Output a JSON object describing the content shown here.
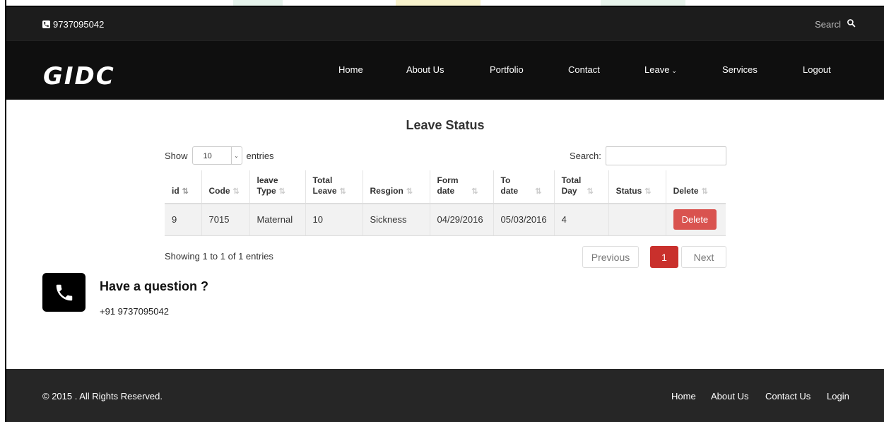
{
  "topbar": {
    "phone": "9737095042",
    "search_label": "Searcl"
  },
  "brand": {
    "logo": "GIDC"
  },
  "nav": {
    "items": [
      {
        "label": "Home"
      },
      {
        "label": "About Us"
      },
      {
        "label": "Portfolio"
      },
      {
        "label": "Contact"
      },
      {
        "label": "Leave",
        "has_dropdown": true
      },
      {
        "label": "Services"
      },
      {
        "label": "Logout"
      }
    ]
  },
  "page": {
    "title": "Leave Status"
  },
  "table_controls": {
    "show_label": "Show",
    "page_size": "10",
    "entries_label": "entries",
    "search_label": "Search:",
    "search_value": ""
  },
  "table": {
    "headers": [
      {
        "line1": "id",
        "line2": ""
      },
      {
        "line1": "Code",
        "line2": ""
      },
      {
        "line1": "leave",
        "line2": "Type"
      },
      {
        "line1": "Total",
        "line2": "Leave"
      },
      {
        "line1": "Resgion",
        "line2": ""
      },
      {
        "line1": "Form",
        "line2": "date"
      },
      {
        "line1": "To",
        "line2": "date"
      },
      {
        "line1": "Total",
        "line2": "Day"
      },
      {
        "line1": "Status",
        "line2": ""
      },
      {
        "line1": "Delete",
        "line2": ""
      }
    ],
    "rows": [
      {
        "id": "9",
        "code": "7015",
        "leave_type": "Maternal",
        "total_leave": "10",
        "reason": "Sickness",
        "from_date": "04/29/2016",
        "to_date": "05/03/2016",
        "total_day": "4",
        "status": "",
        "delete_label": "Delete"
      }
    ],
    "info": "Showing 1 to 1 of 1 entries"
  },
  "pagination": {
    "previous": "Previous",
    "current": "1",
    "next": "Next"
  },
  "contact": {
    "question": "Have a question ?",
    "phone": "+91 9737095042"
  },
  "footer": {
    "copyright": "© 2015 . All Rights Reserved.",
    "links": [
      "Home",
      "About Us",
      "Contact Us",
      "Login"
    ]
  },
  "colors": {
    "topbar_bg": "#1c1c1c",
    "navbar_bg": "#0f0f0f",
    "footer_bg": "#262626",
    "delete_button": "#d9534f",
    "active_page": "#c9302c"
  }
}
